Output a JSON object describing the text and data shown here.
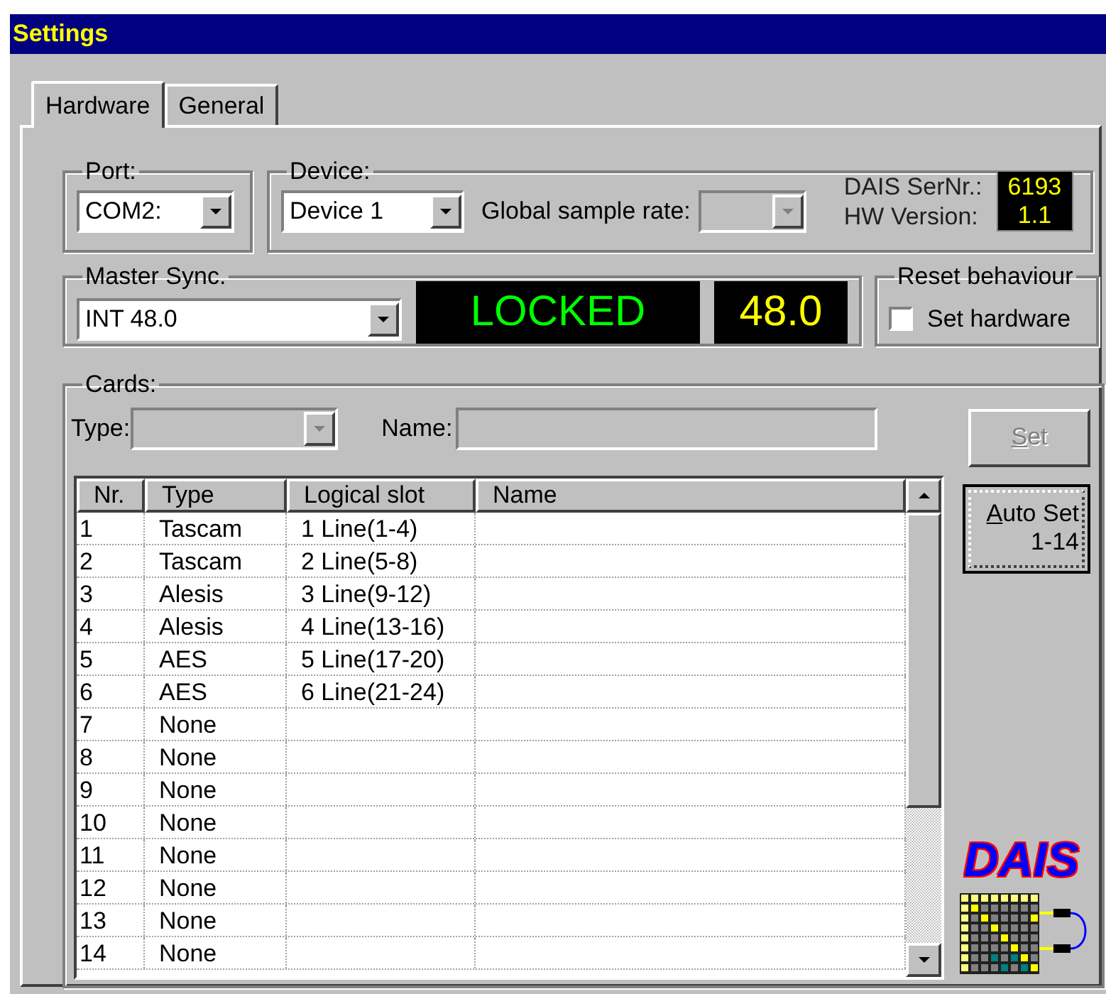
{
  "window": {
    "title": "Settings"
  },
  "tabs": [
    {
      "label": "Hardware",
      "selected": true
    },
    {
      "label": "General",
      "selected": false
    }
  ],
  "port": {
    "label": "Port:",
    "value": "COM2:"
  },
  "device": {
    "label": "Device:",
    "value": "Device 1",
    "sample_rate_label": "Global sample rate:",
    "sample_rate_disabled": true,
    "serial_label": "DAIS SerNr.:",
    "serial": "6193",
    "hw_label": "HW Version:",
    "hw_version": "1.1"
  },
  "master_sync": {
    "label": "Master Sync.",
    "value": "INT 48.0",
    "status": "LOCKED",
    "rate": "48.0"
  },
  "reset": {
    "label": "Reset behaviour",
    "checkbox_label": "Set hardware",
    "checked": false
  },
  "cards": {
    "label": "Cards:",
    "type_label": "Type:",
    "type_disabled": true,
    "name_label": "Name:",
    "buttons": [
      {
        "lines": [
          "Set"
        ],
        "mnemonic_underlined": true,
        "disabled": true,
        "focused": false
      },
      {
        "lines": [
          "Auto Set",
          "1-14"
        ],
        "mnemonic_underlined": true,
        "disabled": false,
        "focused": true
      }
    ],
    "table": {
      "columns": [
        "Nr.",
        "Type",
        "Logical slot",
        "Name"
      ],
      "rows": [
        {
          "nr": "1",
          "type": "Tascam",
          "slot": "1 Line(1-4)"
        },
        {
          "nr": "2",
          "type": "Tascam",
          "slot": "2 Line(5-8)"
        },
        {
          "nr": "3",
          "type": "Alesis",
          "slot": "3 Line(9-12)"
        },
        {
          "nr": "4",
          "type": "Alesis",
          "slot": "4 Line(13-16)"
        },
        {
          "nr": "5",
          "type": "AES",
          "slot": "5 Line(17-20)"
        },
        {
          "nr": "6",
          "type": "AES",
          "slot": "6 Line(21-24)"
        },
        {
          "nr": "7",
          "type": "None"
        },
        {
          "nr": "8",
          "type": "None"
        },
        {
          "nr": "9",
          "type": "None"
        },
        {
          "nr": "10",
          "type": "None"
        },
        {
          "nr": "11",
          "type": "None"
        },
        {
          "nr": "12",
          "type": "None"
        },
        {
          "nr": "13",
          "type": "None"
        },
        {
          "nr": "14",
          "type": "None"
        }
      ]
    },
    "logo": "DAIS"
  }
}
